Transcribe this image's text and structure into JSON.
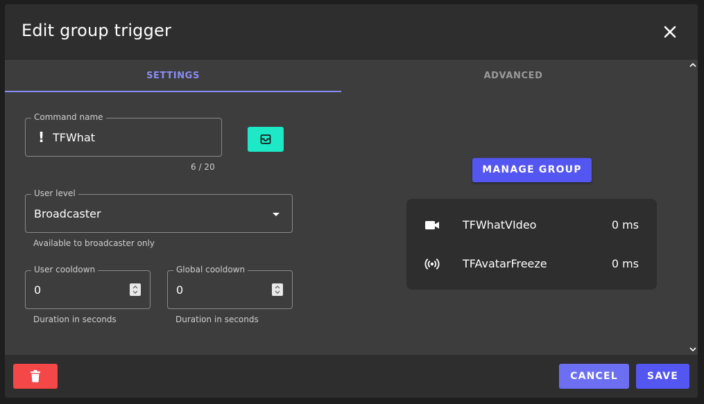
{
  "dialog": {
    "title": "Edit group trigger"
  },
  "tabs": [
    {
      "label": "SETTINGS",
      "active": true
    },
    {
      "label": "ADVANCED",
      "active": false
    }
  ],
  "command": {
    "legend": "Command name",
    "prefix": "!",
    "value": "TFWhat",
    "counter": "6 / 20"
  },
  "user_level": {
    "legend": "User level",
    "value": "Broadcaster",
    "helper": "Available to broadcaster only"
  },
  "user_cooldown": {
    "legend": "User cooldown",
    "value": "0",
    "helper": "Duration in seconds"
  },
  "global_cooldown": {
    "legend": "Global cooldown",
    "value": "0",
    "helper": "Duration in seconds"
  },
  "manage_group": {
    "label": "MANAGE GROUP"
  },
  "group_items": [
    {
      "icon": "video-camera-icon",
      "name": "TFWhatVIdeo",
      "time": "0 ms"
    },
    {
      "icon": "broadcast-icon",
      "name": "TFAvatarFreeze",
      "time": "0 ms"
    }
  ],
  "footer": {
    "cancel_label": "CANCEL",
    "save_label": "SAVE"
  },
  "colors": {
    "accent": "#8a8df5",
    "primary_button": "#5356f0",
    "cancel_button": "#6c6ff2",
    "teal_button": "#1de9c6",
    "delete_button": "#f44747",
    "background": "#2e2e2e",
    "content": "#3d3d3d"
  }
}
